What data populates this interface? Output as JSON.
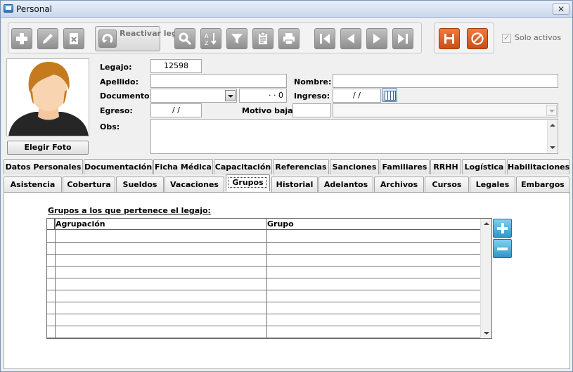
{
  "window": {
    "title": "Personal",
    "close_glyph": "✕"
  },
  "toolbar": {
    "reactivar_label": "Reactivar legajo",
    "solo_activos_label": "Solo activos",
    "solo_activos_checked": true,
    "icons": [
      "add-icon",
      "edit-icon",
      "delete-icon",
      "reactivate-icon",
      "search-icon",
      "sort-icon",
      "filter-icon",
      "report-icon",
      "print-icon",
      "first-record-icon",
      "previous-record-icon",
      "next-record-icon",
      "last-record-icon",
      "save-icon",
      "cancel-icon"
    ]
  },
  "photo": {
    "button_label": "Elegir Foto"
  },
  "form": {
    "legajo_label": "Legajo:",
    "legajo_value": "12598",
    "apellido_label": "Apellido:",
    "apellido_value": "",
    "nombre_label": "Nombre:",
    "nombre_value": "",
    "documento_label": "Documento:",
    "documento_type_value": "",
    "documento_number_value": "·  ·  0",
    "ingreso_label": "Ingreso:",
    "ingreso_value": "/  /",
    "egreso_label": "Egreso:",
    "egreso_value": "/  /",
    "motivo_baja_label": "Motivo baja:",
    "motivo_baja_code_value": "",
    "motivo_baja_desc_value": "",
    "obs_label": "Obs:",
    "obs_value": ""
  },
  "tabs_row1": [
    "Datos Personales",
    "Documentación",
    "Ficha Médica",
    "Capacitación",
    "Referencias",
    "Sanciones",
    "Familiares",
    "RRHH",
    "Logística",
    "Habilitaciones"
  ],
  "tabs_row2": [
    "Asistencia",
    "Cobertura",
    "Sueldos",
    "Vacaciones",
    "Grupos",
    "Historial",
    "Adelantos",
    "Archivos",
    "Cursos",
    "Legales",
    "Embargos"
  ],
  "active_tab": "Grupos",
  "grupos": {
    "title": "Grupos a los que pertenece el legajo:",
    "columns": [
      "Agrupación",
      "Grupo"
    ],
    "rows": []
  }
}
